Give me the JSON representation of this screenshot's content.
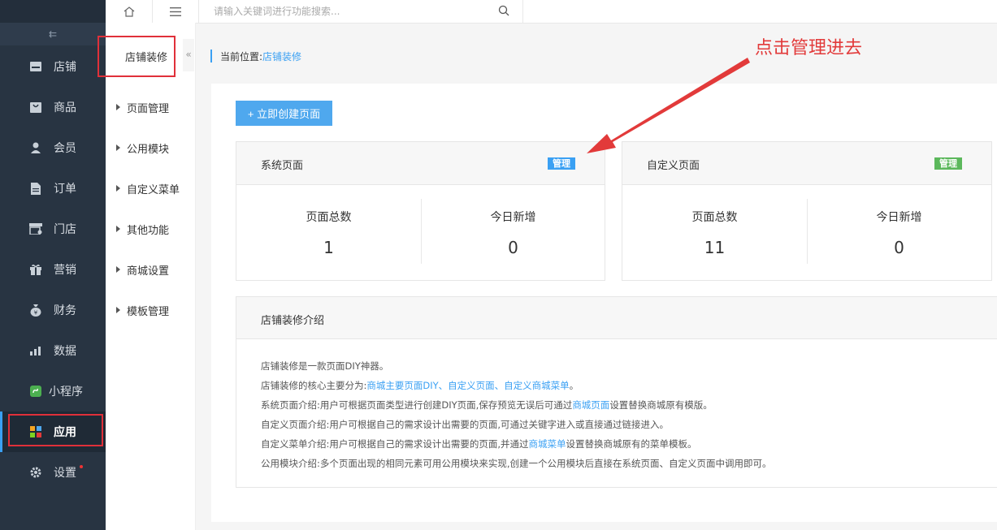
{
  "left_nav": {
    "collapse_glyph": "⇇",
    "items": [
      {
        "label": "店铺",
        "icon": "store-icon"
      },
      {
        "label": "商品",
        "icon": "bag-icon"
      },
      {
        "label": "会员",
        "icon": "user-icon"
      },
      {
        "label": "订单",
        "icon": "document-icon"
      },
      {
        "label": "门店",
        "icon": "shop-icon"
      },
      {
        "label": "营销",
        "icon": "gift-icon"
      },
      {
        "label": "财务",
        "icon": "money-bag-icon"
      },
      {
        "label": "数据",
        "icon": "bar-chart-icon"
      },
      {
        "label": "小程序",
        "icon": "miniprogram-icon"
      },
      {
        "label": "应用",
        "icon": "apps-icon"
      },
      {
        "label": "设置",
        "icon": "gear-icon"
      }
    ],
    "active_item": "应用"
  },
  "topbar": {
    "search_placeholder": "请输入关键词进行功能搜索..."
  },
  "sub_nav": {
    "title": "店铺装修",
    "toggle_glyph": "«",
    "items": [
      "页面管理",
      "公用模块",
      "自定义菜单",
      "其他功能",
      "商城设置",
      "模板管理"
    ]
  },
  "breadcrumb": {
    "prefix": "当前位置:",
    "current": "店铺装修"
  },
  "main": {
    "create_button": "+ 立即创建页面",
    "system_card": {
      "title": "系统页面",
      "manage": "管理",
      "stats": [
        {
          "label": "页面总数",
          "value": "1"
        },
        {
          "label": "今日新增",
          "value": "0"
        }
      ]
    },
    "custom_card": {
      "title": "自定义页面",
      "manage": "管理",
      "stats": [
        {
          "label": "页面总数",
          "value": "11"
        },
        {
          "label": "今日新增",
          "value": "0"
        }
      ]
    },
    "intro": {
      "title": "店铺装修介绍",
      "line1": "店铺装修是一款页面DIY神器。",
      "line2_prefix": "店铺装修的核心主要分为:",
      "line2_link1": "商城主要页面DIY",
      "line2_sep1": "、",
      "line2_link2": "自定义页面",
      "line2_sep2": "、",
      "line2_link3": "自定义商城菜单",
      "line2_suffix": "。",
      "line3_prefix": "系统页面介绍:用户可根据页面类型进行创建DIY页面,保存预览无误后可通过",
      "line3_link": "商城页面",
      "line3_suffix": "设置替换商城原有模版。",
      "line4": "自定义页面介绍:用户可根据自己的需求设计出需要的页面,可通过关键字进入或直接通过链接进入。",
      "line5_prefix": "自定义菜单介绍:用户可根据自己的需求设计出需要的页面,并通过",
      "line5_link": "商城菜单",
      "line5_suffix": "设置替换商城原有的菜单模板。",
      "line6": "公用模块介绍:多个页面出现的相同元素可用公用模块来实现,创建一个公用模块后直接在系统页面、自定义页面中调用即可。"
    }
  },
  "annotation": {
    "text": "点击管理进去"
  },
  "colors": {
    "nav_bg": "#283442",
    "accent_blue": "#4fa8ee",
    "tag_blue": "#3aa0f3",
    "tag_green": "#5cb85c",
    "annotation_red": "#e23a3a"
  }
}
